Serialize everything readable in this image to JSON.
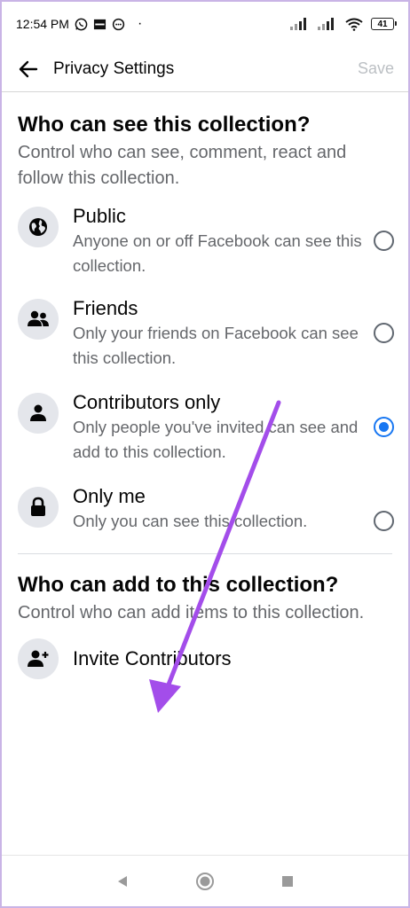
{
  "status_bar": {
    "time": "12:54 PM",
    "battery": "41",
    "icons": [
      "whatsapp-icon",
      "notification-icon",
      "messenger-icon",
      "signal-icon",
      "wifi-icon",
      "battery-icon"
    ]
  },
  "app_bar": {
    "title": "Privacy Settings",
    "save_label": "Save"
  },
  "visibility_section": {
    "title": "Who can see this collection?",
    "description": "Control who can see, comment, react and follow this collection.",
    "options": [
      {
        "label": "Public",
        "subtitle": "Anyone on or off Facebook can see this collection.",
        "icon": "globe-icon",
        "selected": false
      },
      {
        "label": "Friends",
        "subtitle": "Only your friends on Facebook can see this collection.",
        "icon": "friends-icon",
        "selected": false
      },
      {
        "label": "Contributors only",
        "subtitle": "Only people you've invited can see and add to this collection.",
        "icon": "person-icon",
        "selected": true
      },
      {
        "label": "Only me",
        "subtitle": "Only you can see this collection.",
        "icon": "lock-icon",
        "selected": false
      }
    ]
  },
  "contributors_section": {
    "title": "Who can add to this collection?",
    "description": "Control who can add items to this collection.",
    "invite_label": "Invite Contributors"
  },
  "colors": {
    "accent": "#1877f2",
    "secondary_text": "#65676b",
    "disabled": "#bcc0c4",
    "annotation_arrow": "#a34dea"
  }
}
